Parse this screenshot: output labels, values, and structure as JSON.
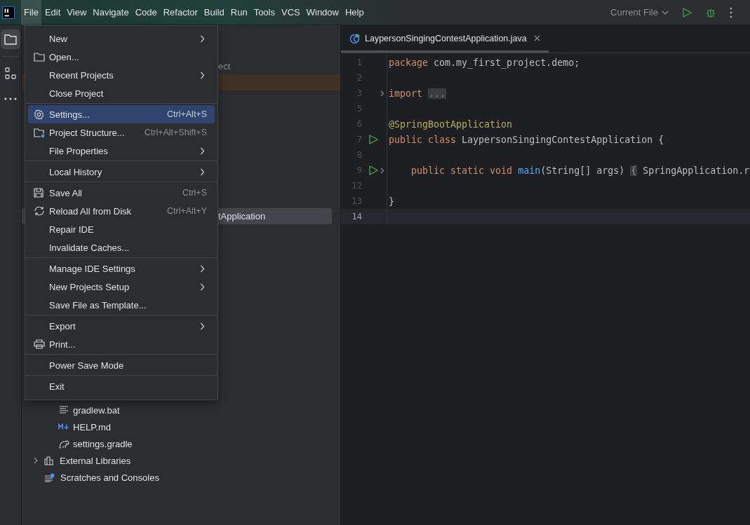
{
  "main_menu": [
    {
      "label": "File",
      "selected": true
    },
    {
      "label": "Edit",
      "selected": false
    },
    {
      "label": "View",
      "selected": false
    },
    {
      "label": "Navigate",
      "selected": false
    },
    {
      "label": "Code",
      "selected": false
    },
    {
      "label": "Refactor",
      "selected": false
    },
    {
      "label": "Build",
      "selected": false
    },
    {
      "label": "Run",
      "selected": false
    },
    {
      "label": "Tools",
      "selected": false
    },
    {
      "label": "VCS",
      "selected": false
    },
    {
      "label": "Window",
      "selected": false
    },
    {
      "label": "Help",
      "selected": false
    }
  ],
  "run_config": {
    "label": "Current File"
  },
  "tool_strip": [
    {
      "kind": "project",
      "selected": true
    },
    {
      "kind": "structure",
      "selected": false
    },
    {
      "kind": "more",
      "selected": false
    }
  ],
  "project_tree": {
    "partial_rows": [
      {
        "text": "ect",
        "selected": false
      },
      {
        "text": "tApplication",
        "selected": true
      }
    ],
    "files": [
      {
        "label": "gradlew.bat",
        "kind": "text"
      },
      {
        "label": "HELP.md",
        "kind": "markdown"
      },
      {
        "label": "settings.gradle",
        "kind": "gradle"
      }
    ],
    "roots": [
      {
        "label": "External Libraries",
        "kind": "library"
      },
      {
        "label": "Scratches and Consoles",
        "kind": "scratch"
      }
    ]
  },
  "file_menu": [
    [
      {
        "label": "New",
        "kind": "plain",
        "submenu": true,
        "selected": false
      },
      {
        "label": "Open...",
        "kind": "folder",
        "submenu": false,
        "selected": false
      },
      {
        "label": "Recent Projects",
        "kind": "plain",
        "submenu": true,
        "selected": false
      },
      {
        "label": "Close Project",
        "kind": "plain",
        "submenu": false,
        "selected": false
      }
    ],
    [
      {
        "label": "Settings...",
        "kind": "gear",
        "shortcut": "Ctrl+Alt+S",
        "submenu": false,
        "selected": true
      },
      {
        "label": "Project Structure...",
        "kind": "structure",
        "shortcut": "Ctrl+Alt+Shift+S",
        "submenu": false,
        "selected": false
      },
      {
        "label": "File Properties",
        "kind": "plain",
        "submenu": true,
        "selected": false
      }
    ],
    [
      {
        "label": "Local History",
        "kind": "plain",
        "submenu": true,
        "selected": false
      }
    ],
    [
      {
        "label": "Save All",
        "kind": "save",
        "shortcut": "Ctrl+S",
        "submenu": false,
        "selected": false
      },
      {
        "label": "Reload All from Disk",
        "kind": "reload",
        "shortcut": "Ctrl+Alt+Y",
        "submenu": false,
        "selected": false
      },
      {
        "label": "Repair IDE",
        "kind": "plain",
        "submenu": false,
        "selected": false
      },
      {
        "label": "Invalidate Caches...",
        "kind": "plain",
        "submenu": false,
        "selected": false
      }
    ],
    [
      {
        "label": "Manage IDE Settings",
        "kind": "plain",
        "submenu": true,
        "selected": false
      },
      {
        "label": "New Projects Setup",
        "kind": "plain",
        "submenu": true,
        "selected": false
      },
      {
        "label": "Save File as Template...",
        "kind": "plain",
        "submenu": false,
        "selected": false
      }
    ],
    [
      {
        "label": "Export",
        "kind": "plain",
        "submenu": true,
        "selected": false
      },
      {
        "label": "Print...",
        "kind": "print",
        "submenu": false,
        "selected": false
      }
    ],
    [
      {
        "label": "Power Save Mode",
        "kind": "plain",
        "submenu": false,
        "selected": false
      }
    ],
    [
      {
        "label": "Exit",
        "kind": "plain",
        "submenu": false,
        "selected": false
      }
    ]
  ],
  "editor": {
    "tab": {
      "label": "LaypersonSingingContestApplication.java",
      "selected": true
    },
    "lines": [
      {
        "number": "1",
        "run": false,
        "fold": false,
        "current": false,
        "tokens": [
          {
            "kind": "keyword",
            "text": "package"
          },
          {
            "kind": "plain",
            "text": " com.my_first_project.demo;"
          }
        ]
      },
      {
        "number": "2",
        "run": false,
        "fold": false,
        "current": false
      },
      {
        "number": "3",
        "run": false,
        "fold": true,
        "current": false,
        "tokens": [
          {
            "kind": "keyword",
            "text": "import "
          },
          {
            "kind": "folded",
            "text": "..."
          }
        ]
      },
      {
        "number": "5",
        "run": false,
        "fold": false,
        "current": false
      },
      {
        "number": "6",
        "run": false,
        "fold": false,
        "current": false,
        "tokens": [
          {
            "kind": "annotation",
            "text": "@SpringBootApplication"
          }
        ]
      },
      {
        "number": "7",
        "run": true,
        "fold": false,
        "current": false,
        "tokens": [
          {
            "kind": "keyword",
            "text": "public class"
          },
          {
            "kind": "plain",
            "text": " LaypersonSingingContestApplication {"
          }
        ]
      },
      {
        "number": "8",
        "run": false,
        "fold": false,
        "current": false
      },
      {
        "number": "9",
        "run": true,
        "fold": true,
        "current": false,
        "tokens": [
          {
            "kind": "keyword",
            "text": "    public static void"
          },
          {
            "kind": "method",
            "text": " main"
          },
          {
            "kind": "plain",
            "text": "(String[] args) "
          },
          {
            "kind": "folded",
            "text": "{"
          },
          {
            "kind": "plain",
            "text": " SpringApplication.r"
          }
        ]
      },
      {
        "number": "12",
        "run": false,
        "fold": false,
        "current": false
      },
      {
        "number": "13",
        "run": false,
        "fold": false,
        "current": false,
        "tokens": [
          {
            "kind": "plain",
            "text": "}"
          }
        ]
      },
      {
        "number": "14",
        "run": false,
        "fold": false,
        "current": true
      }
    ]
  }
}
